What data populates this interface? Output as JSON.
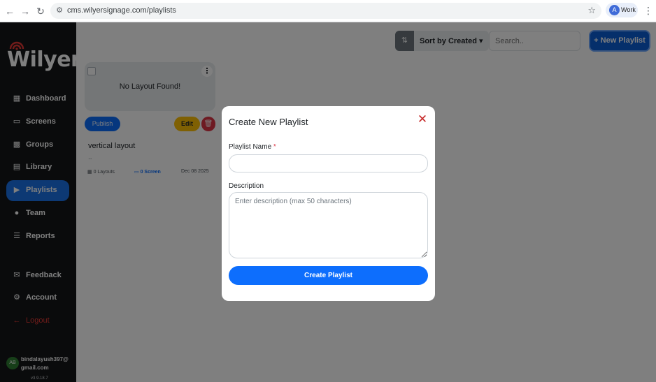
{
  "browser": {
    "url": "cms.wilyersignage.com/playlists",
    "profile_initial": "A",
    "profile_label": "Work"
  },
  "brand": {
    "logo_text": "Wilyer",
    "logo_dot": ".",
    "accent": "#1a73e8"
  },
  "sidebar": {
    "items": [
      {
        "label": "Dashboard",
        "icon": "dashboard-icon"
      },
      {
        "label": "Screens",
        "icon": "screen-icon"
      },
      {
        "label": "Groups",
        "icon": "grid-icon"
      },
      {
        "label": "Library",
        "icon": "film-icon"
      },
      {
        "label": "Playlists",
        "icon": "playlist-icon",
        "active": true
      },
      {
        "label": "Team",
        "icon": "team-icon"
      },
      {
        "label": "Reports",
        "icon": "clipboard-icon"
      },
      {
        "label": "Feedback",
        "icon": "feedback-icon"
      },
      {
        "label": "Account",
        "icon": "gear-icon"
      },
      {
        "label": "Logout",
        "icon": "logout-icon"
      }
    ],
    "user_initials": "AB",
    "user_email": "bindalayush397@gmail.com",
    "version": "v3.9.18.7"
  },
  "toolbar": {
    "sort_label": "Sort by Created",
    "search_placeholder": "Search..",
    "new_button": "+ New Playlist"
  },
  "card": {
    "thumb_text": "No Layout Found!",
    "publish": "Publish",
    "edit": "Edit",
    "title": "vertical layout",
    "description": "..",
    "layouts": "0 Layouts",
    "screens": "0 Screen",
    "date": "Dec 08 2025"
  },
  "modal": {
    "title": "Create New Playlist",
    "name_label": "Playlist Name",
    "required_mark": "*",
    "desc_label": "Description",
    "desc_placeholder": "Enter description (max 50 characters)",
    "submit": "Create Playlist"
  }
}
